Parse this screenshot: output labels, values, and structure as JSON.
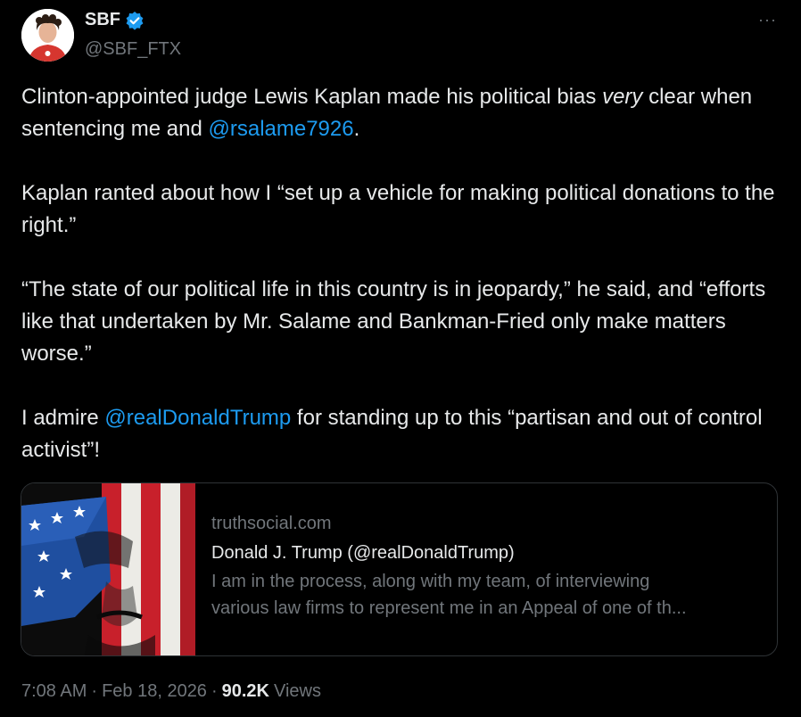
{
  "author": {
    "name": "SBF",
    "handle": "@SBF_FTX"
  },
  "more_label": "···",
  "tweet": {
    "p1": {
      "a": "Clinton-appointed judge Lewis Kaplan made his political bias ",
      "emph": "very",
      "b": " clear when sentencing me and ",
      "mention": "@rsalame7926",
      "c": "."
    },
    "p2": "Kaplan ranted about how I “set up a vehicle for making political donations to the right.”",
    "p3": "“The state of our political life in this country is in jeopardy,” he said, and “efforts like that undertaken by Mr. Salame and Bankman-Fried only make matters worse.”",
    "p4": {
      "a": "I admire ",
      "mention": "@realDonaldTrump",
      "b": " for standing up to this “partisan and out of control activist”!"
    }
  },
  "card": {
    "domain": "truthsocial.com",
    "title": "Donald J. Trump (@realDonaldTrump)",
    "desc_line1": "I am in the process, along with my team, of interviewing",
    "desc_line2": "various law firms to represent me in an Appeal of one of th..."
  },
  "meta": {
    "time": "7:08 AM",
    "date": "Feb 18, 2026",
    "views_count": "90.2K",
    "views_label": "Views",
    "sep": "·"
  },
  "colors": {
    "background": "#000000",
    "text": "#e7e9ea",
    "secondary": "#71767b",
    "link": "#1d9bf0",
    "verified": "#1d9bf0"
  }
}
